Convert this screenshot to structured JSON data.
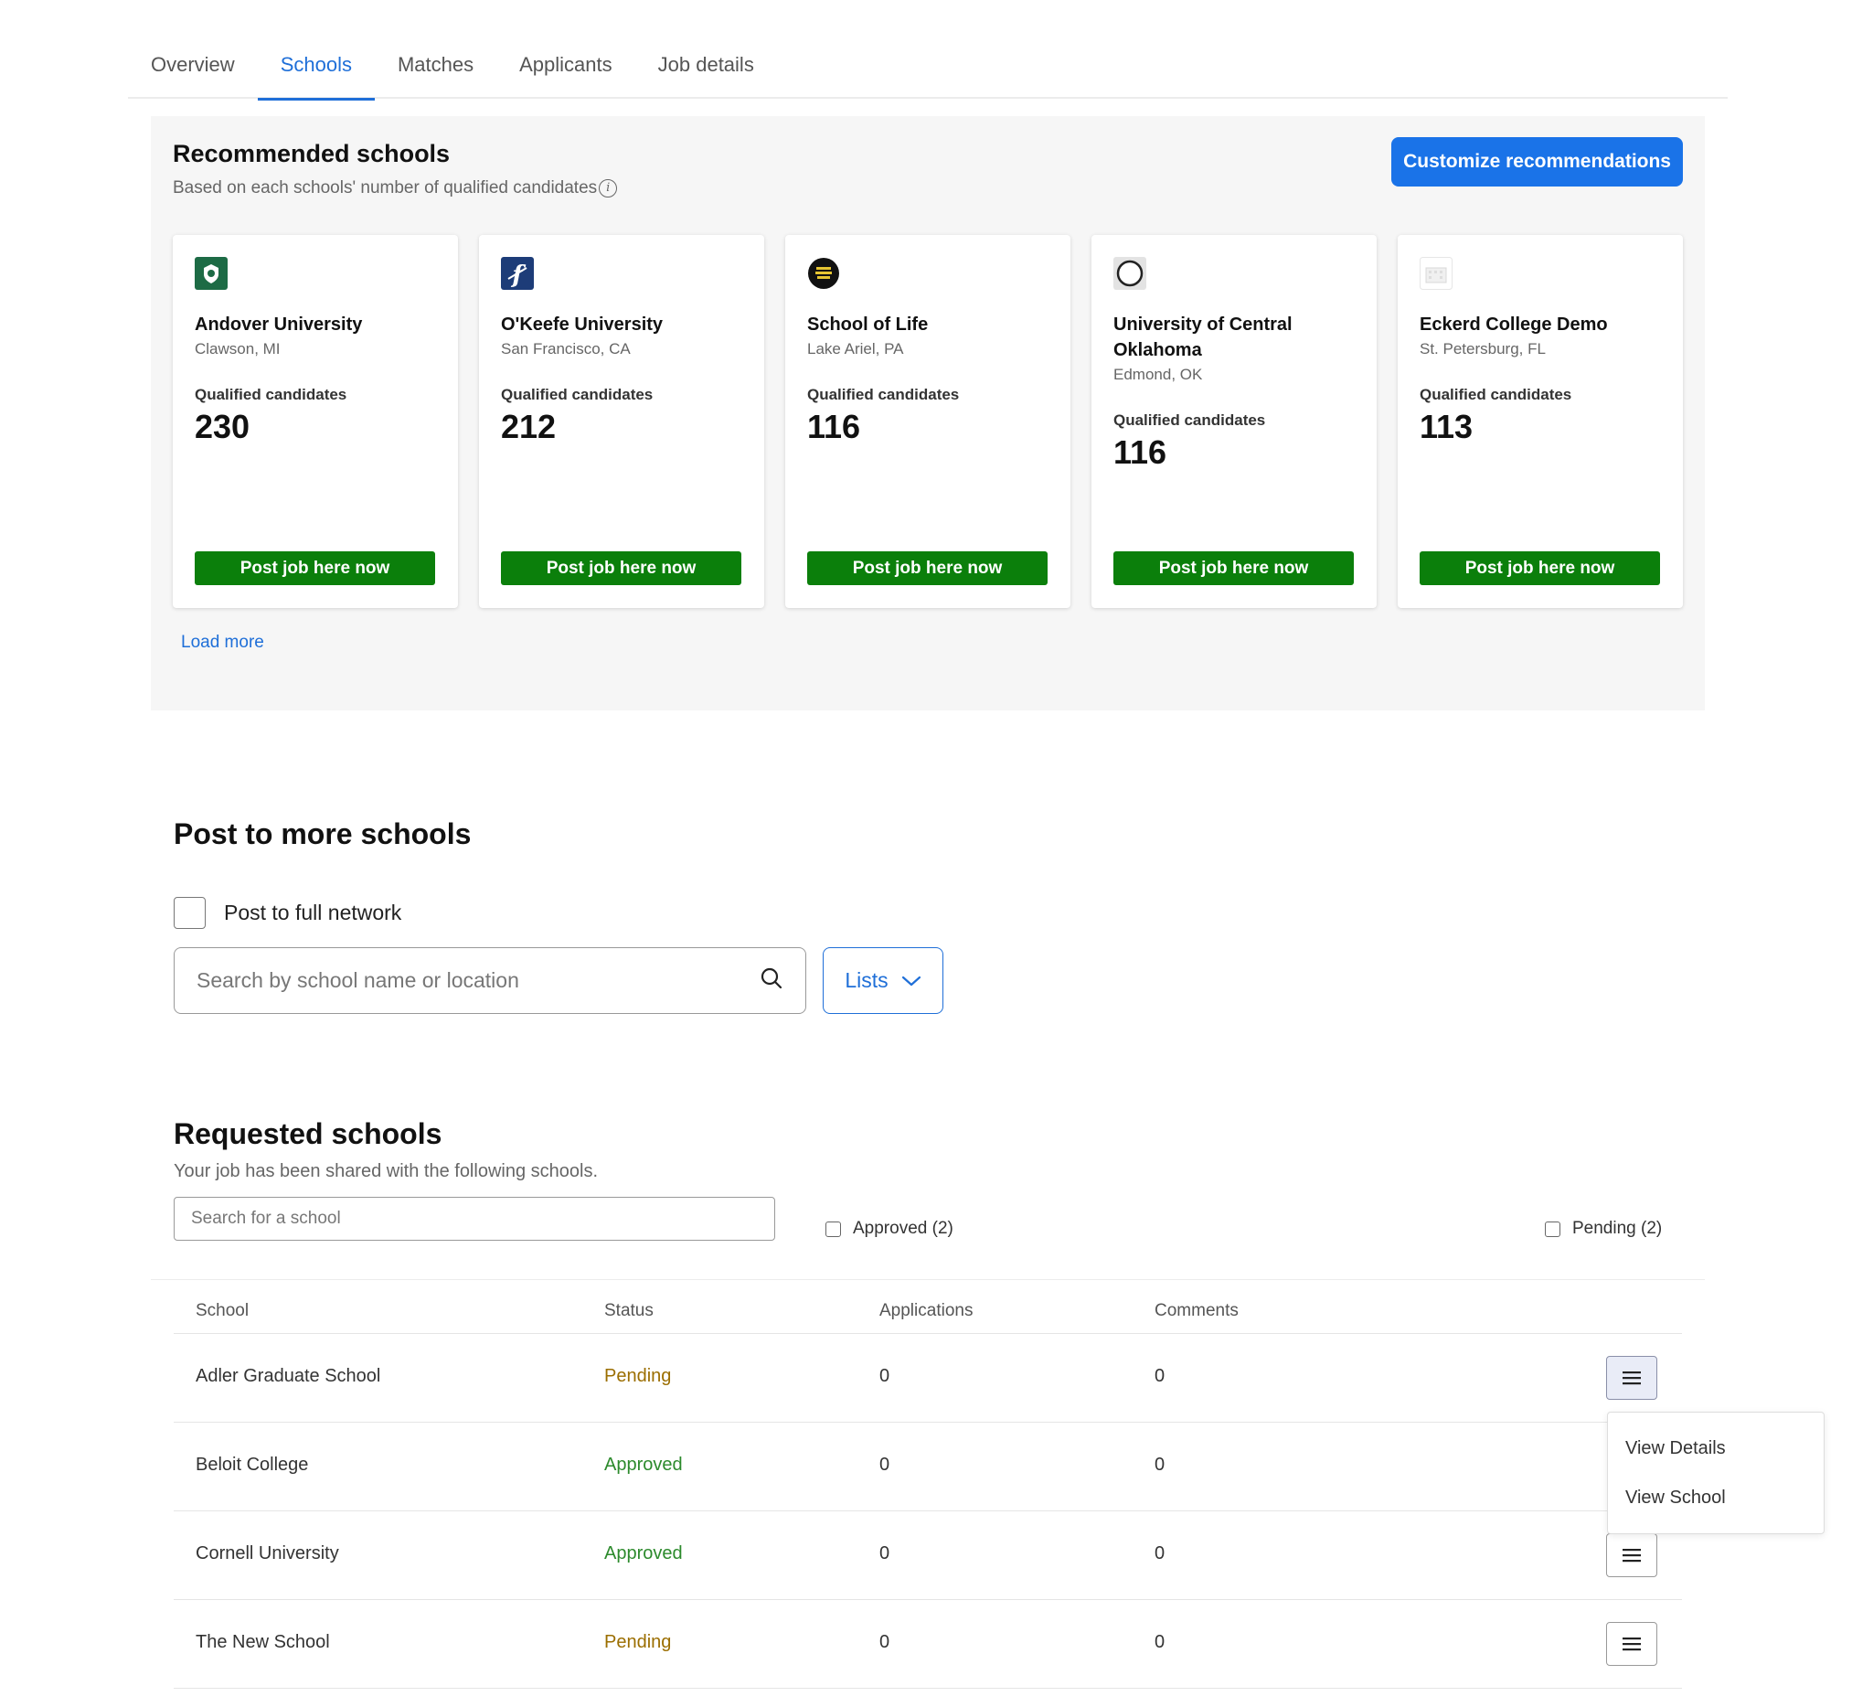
{
  "tabs": [
    {
      "label": "Overview",
      "active": false
    },
    {
      "label": "Schools",
      "active": true
    },
    {
      "label": "Matches",
      "active": false
    },
    {
      "label": "Applicants",
      "active": false
    },
    {
      "label": "Job details",
      "active": false
    }
  ],
  "recommended": {
    "title": "Recommended schools",
    "subtitle": "Based on each schools' number of qualified candidates",
    "info_icon": "info-icon",
    "customize_label": "Customize recommendations",
    "qualified_label": "Qualified candidates",
    "post_label": "Post job here now",
    "load_more_label": "Load more",
    "cards": [
      {
        "name": "Andover University",
        "location": "Clawson, MI",
        "qualified": "230",
        "logo": "green-crest-logo"
      },
      {
        "name": "O'Keefe University",
        "location": "San Francisco, CA",
        "qualified": "212",
        "logo": "blue-f-logo"
      },
      {
        "name": "School of Life",
        "location": "Lake Ariel, PA",
        "qualified": "116",
        "logo": "black-circle-logo"
      },
      {
        "name": "University of Central Oklahoma",
        "location": "Edmond, OK",
        "qualified": "116",
        "logo": "ring-logo"
      },
      {
        "name": "Eckerd College Demo",
        "location": "St. Petersburg, FL",
        "qualified": "113",
        "logo": "building-placeholder-logo"
      }
    ]
  },
  "post_more": {
    "title": "Post to more schools",
    "full_network_label": "Post to full network",
    "search_placeholder": "Search by school name or location",
    "lists_label": "Lists"
  },
  "requested": {
    "title": "Requested schools",
    "subtitle": "Your job has been shared with the following schools.",
    "search_placeholder": "Search for a school",
    "filters": {
      "approved": "Approved (2)",
      "pending": "Pending (2)"
    },
    "columns": [
      "School",
      "Status",
      "Applications",
      "Comments"
    ],
    "rows": [
      {
        "school": "Adler Graduate School",
        "status": "Pending",
        "applications": "0",
        "comments": "0"
      },
      {
        "school": "Beloit College",
        "status": "Approved",
        "applications": "0",
        "comments": "0"
      },
      {
        "school": "Cornell University",
        "status": "Approved",
        "applications": "0",
        "comments": "0"
      },
      {
        "school": "The New School",
        "status": "Pending",
        "applications": "0",
        "comments": "0"
      }
    ],
    "menu": [
      "View Details",
      "View School"
    ]
  },
  "colors": {
    "accent": "#1a73e8",
    "post_button": "#0b7f0b",
    "pending": "#9b6e00",
    "approved": "#2c8a2c"
  }
}
